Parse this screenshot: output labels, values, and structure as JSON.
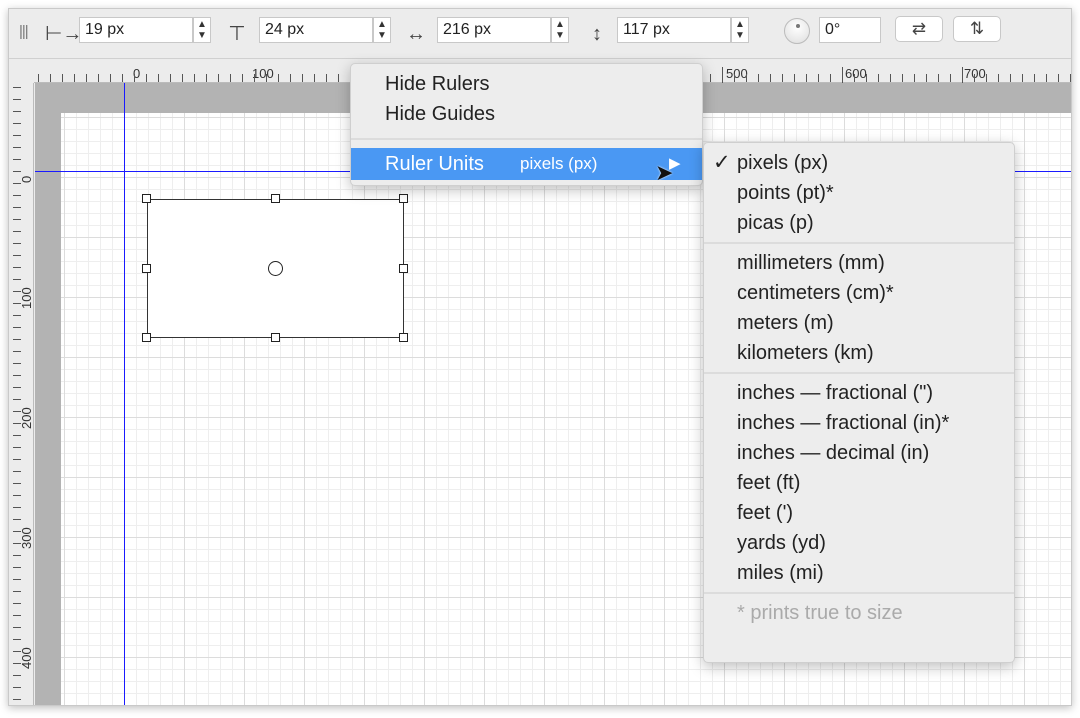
{
  "toolbar": {
    "x_value": "19 px",
    "y_value": "24 px",
    "width_value": "216 px",
    "height_value": "117 px",
    "rotation_value": "0°",
    "flip_horizontal_icon": "⇄",
    "flip_vertical_icon": "⇅"
  },
  "rulers": {
    "horizontal_labels": [
      "0",
      "100",
      "500",
      "600",
      "700"
    ],
    "vertical_labels": [
      "0",
      "100",
      "200",
      "300",
      "400"
    ]
  },
  "context_menu": {
    "items": [
      {
        "label": "Hide Rulers"
      },
      {
        "label": "Hide Guides"
      }
    ],
    "ruler_units": {
      "label": "Ruler Units",
      "value": "pixels (px)"
    }
  },
  "units_submenu": {
    "groups": [
      [
        {
          "label": "pixels (px)",
          "checked": true
        },
        {
          "label": "points (pt)*"
        },
        {
          "label": "picas (p)"
        }
      ],
      [
        {
          "label": "millimeters (mm)"
        },
        {
          "label": "centimeters (cm)*"
        },
        {
          "label": "meters (m)"
        },
        {
          "label": "kilometers (km)"
        }
      ],
      [
        {
          "label": "inches — fractional (\")"
        },
        {
          "label": "inches — fractional (in)*"
        },
        {
          "label": "inches — decimal (in)"
        },
        {
          "label": "feet (ft)"
        },
        {
          "label": "feet (')"
        },
        {
          "label": "yards (yd)"
        },
        {
          "label": "miles (mi)"
        }
      ]
    ],
    "checkmark": "✓",
    "footnote": "* prints true to size"
  },
  "colors": {
    "highlight": "#4a98f3",
    "guide": "#1a1aff"
  }
}
